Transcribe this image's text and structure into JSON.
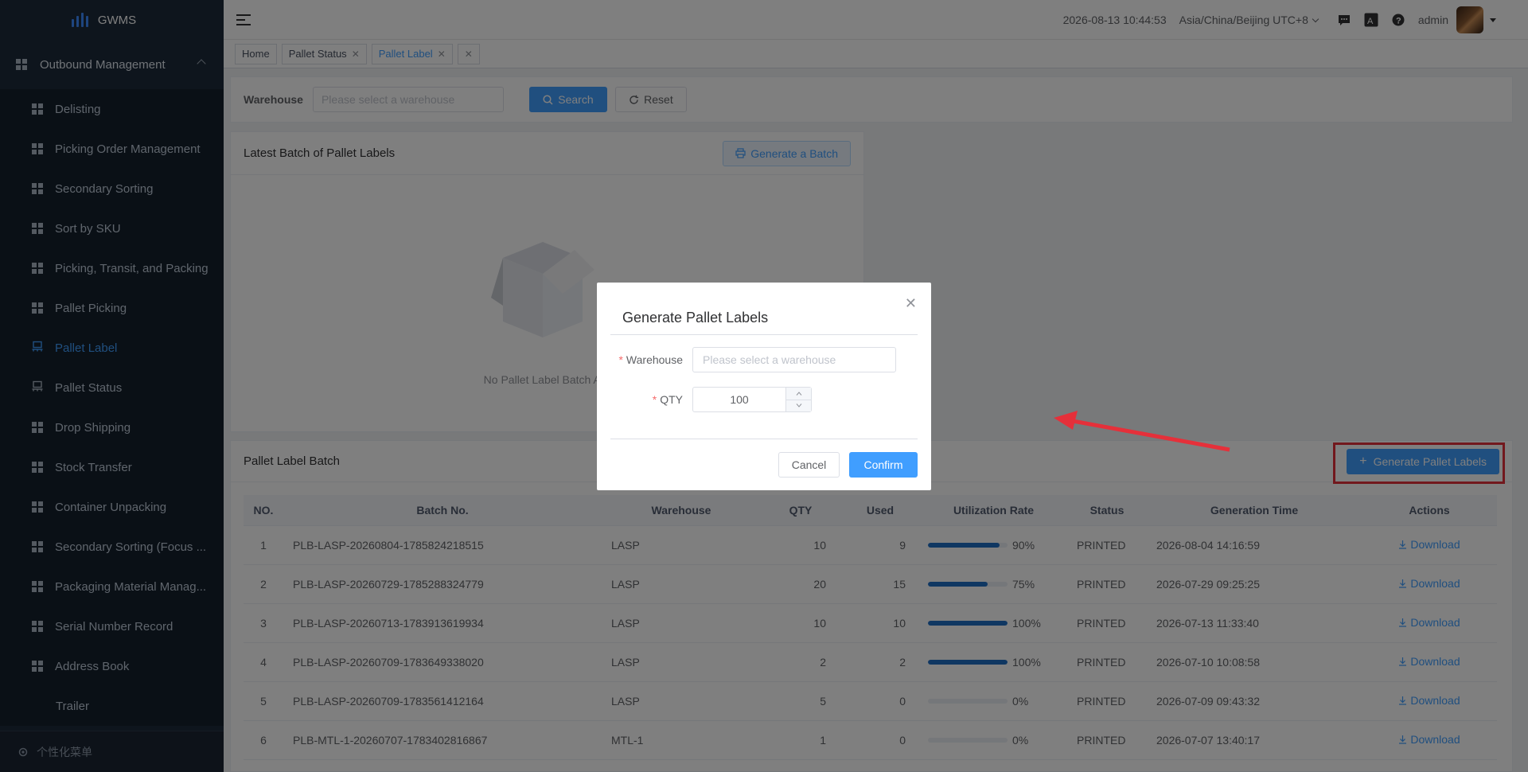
{
  "app": {
    "name": "GWMS"
  },
  "sidebar": {
    "group_label": "Outbound Management",
    "items": [
      {
        "label": "Delisting",
        "icon": "grid-icon"
      },
      {
        "label": "Picking Order Management",
        "icon": "grid-icon"
      },
      {
        "label": "Secondary Sorting",
        "icon": "grid-icon"
      },
      {
        "label": "Sort by SKU",
        "icon": "grid-icon"
      },
      {
        "label": "Picking, Transit, and Packing",
        "icon": "grid-icon"
      },
      {
        "label": "Pallet Picking",
        "icon": "grid-icon"
      },
      {
        "label": "Pallet Label",
        "icon": "pallet-icon",
        "active": true
      },
      {
        "label": "Pallet Status",
        "icon": "pallet-icon"
      },
      {
        "label": "Drop Shipping",
        "icon": "grid-icon"
      },
      {
        "label": "Stock Transfer",
        "icon": "grid-icon"
      },
      {
        "label": "Container Unpacking",
        "icon": "grid-icon"
      },
      {
        "label": "Secondary Sorting (Focus ...",
        "icon": "grid-icon"
      },
      {
        "label": "Packaging Material Manag...",
        "icon": "grid-icon"
      },
      {
        "label": "Serial Number Record",
        "icon": "grid-icon"
      },
      {
        "label": "Address Book",
        "icon": "grid-icon"
      },
      {
        "label": "Trailer",
        "icon": ""
      }
    ],
    "footer_label": "个性化菜单"
  },
  "topbar": {
    "datetime": "2026-08-13 10:44:53",
    "timezone": "Asia/China/Beijing UTC+8",
    "user": "admin"
  },
  "tags": [
    {
      "label": "Home",
      "closable": false,
      "active": false
    },
    {
      "label": "Pallet Status",
      "closable": true,
      "active": false
    },
    {
      "label": "Pallet Label",
      "closable": true,
      "active": true
    }
  ],
  "filter": {
    "warehouse_label": "Warehouse",
    "warehouse_placeholder": "Please select a warehouse",
    "search_label": "Search",
    "reset_label": "Reset"
  },
  "latest_panel": {
    "title": "Latest Batch of Pallet Labels",
    "generate_batch_label": "Generate a Batch",
    "empty_text": "No Pallet Label Batch Ava"
  },
  "batch_panel": {
    "title": "Pallet Label Batch",
    "generate_label": "Generate Pallet Labels",
    "columns": [
      "NO.",
      "Batch No.",
      "Warehouse",
      "QTY",
      "Used",
      "Utilization Rate",
      "Status",
      "Generation Time",
      "Actions"
    ],
    "rows": [
      {
        "no": "1",
        "batch_no": "PLB-LASP-20260804-1785824218515",
        "warehouse": "LASP",
        "qty": "10",
        "used": "9",
        "rate": 90,
        "rate_text": "90%",
        "status": "PRINTED",
        "time": "2026-08-04 14:16:59",
        "action": "Download"
      },
      {
        "no": "2",
        "batch_no": "PLB-LASP-20260729-1785288324779",
        "warehouse": "LASP",
        "qty": "20",
        "used": "15",
        "rate": 75,
        "rate_text": "75%",
        "status": "PRINTED",
        "time": "2026-07-29 09:25:25",
        "action": "Download"
      },
      {
        "no": "3",
        "batch_no": "PLB-LASP-20260713-1783913619934",
        "warehouse": "LASP",
        "qty": "10",
        "used": "10",
        "rate": 100,
        "rate_text": "100%",
        "status": "PRINTED",
        "time": "2026-07-13 11:33:40",
        "action": "Download"
      },
      {
        "no": "4",
        "batch_no": "PLB-LASP-20260709-1783649338020",
        "warehouse": "LASP",
        "qty": "2",
        "used": "2",
        "rate": 100,
        "rate_text": "100%",
        "status": "PRINTED",
        "time": "2026-07-10 10:08:58",
        "action": "Download"
      },
      {
        "no": "5",
        "batch_no": "PLB-LASP-20260709-1783561412164",
        "warehouse": "LASP",
        "qty": "5",
        "used": "0",
        "rate": 0,
        "rate_text": "0%",
        "status": "PRINTED",
        "time": "2026-07-09 09:43:32",
        "action": "Download"
      },
      {
        "no": "6",
        "batch_no": "PLB-MTL-1-20260707-1783402816867",
        "warehouse": "MTL-1",
        "qty": "1",
        "used": "0",
        "rate": 0,
        "rate_text": "0%",
        "status": "PRINTED",
        "time": "2026-07-07 13:40:17",
        "action": "Download"
      }
    ]
  },
  "modal": {
    "title": "Generate Pallet Labels",
    "warehouse_label": "Warehouse",
    "warehouse_placeholder": "Please select a warehouse",
    "qty_label": "QTY",
    "qty_value": "100",
    "cancel_label": "Cancel",
    "confirm_label": "Confirm"
  },
  "colors": {
    "primary": "#409eff",
    "sidebar_bg": "#1d2a3a",
    "highlight_outline": "#e5303a",
    "progress": "#1f6fc5"
  }
}
